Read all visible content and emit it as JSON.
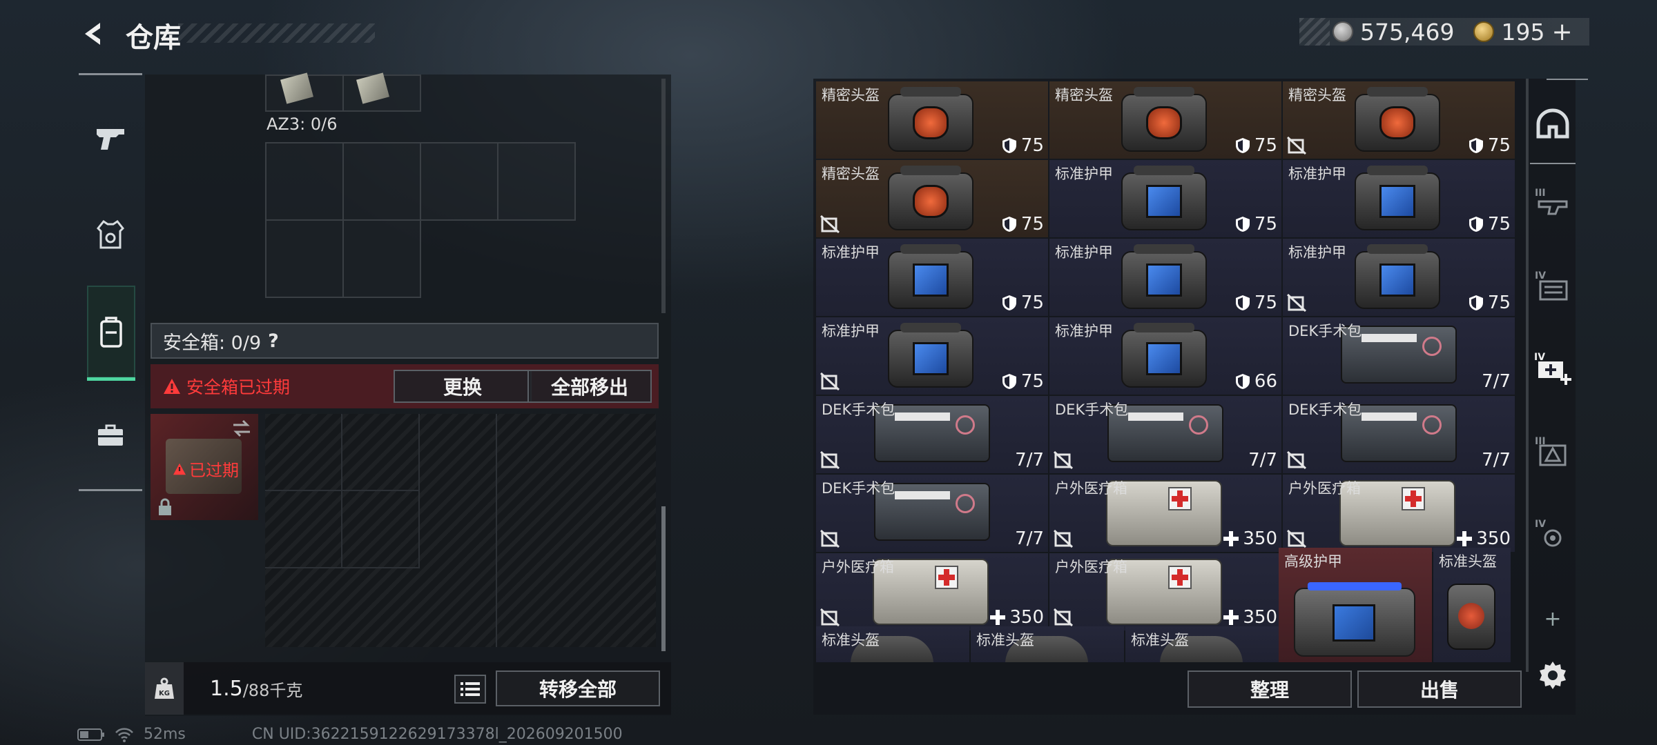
{
  "header": {
    "title": "仓库",
    "back_icon": "back-arrow-icon"
  },
  "currency": {
    "silver": "575,469",
    "gold": "195",
    "gold_plus": "+"
  },
  "left_nav": {
    "items": [
      {
        "name": "weapons",
        "icon": "pistol-icon"
      },
      {
        "name": "gear",
        "icon": "armor-vest-icon"
      },
      {
        "name": "backpack",
        "icon": "backpack-icon",
        "active": true
      },
      {
        "name": "toolbox",
        "icon": "briefcase-icon"
      }
    ]
  },
  "storage": {
    "az3_label": "AZ3: 0/6"
  },
  "safebox": {
    "label": "安全箱: 0/9",
    "help": "?",
    "expired_msg": "安全箱已过期",
    "replace_btn": "更换",
    "remove_all_btn": "全部移出",
    "thumb_tag": "已过期"
  },
  "footer": {
    "weight": "1.5",
    "weight_max": "/88千克",
    "kg_icon": "KG",
    "transfer_all_btn": "转移全部",
    "sort_btn": "整理",
    "sell_btn": "出售"
  },
  "inventory": {
    "items": [
      {
        "name": "精密头盔",
        "value": "75",
        "kind": "helmet",
        "tone": "brown",
        "value_icon": "shield",
        "nosell": false
      },
      {
        "name": "精密头盔",
        "value": "75",
        "kind": "helmet",
        "tone": "brown",
        "value_icon": "shield",
        "nosell": false
      },
      {
        "name": "精密头盔",
        "value": "75",
        "kind": "helmet",
        "tone": "brown",
        "value_icon": "shield",
        "nosell": true
      },
      {
        "name": "精密头盔",
        "value": "75",
        "kind": "helmet",
        "tone": "brown",
        "value_icon": "shield",
        "nosell": true
      },
      {
        "name": "标准护甲",
        "value": "75",
        "kind": "armor",
        "tone": "navy",
        "value_icon": "shield",
        "nosell": false
      },
      {
        "name": "标准护甲",
        "value": "75",
        "kind": "armor",
        "tone": "navy",
        "value_icon": "shield",
        "nosell": false
      },
      {
        "name": "标准护甲",
        "value": "75",
        "kind": "armor",
        "tone": "navy",
        "value_icon": "shield",
        "nosell": false
      },
      {
        "name": "标准护甲",
        "value": "75",
        "kind": "armor",
        "tone": "navy",
        "value_icon": "shield",
        "nosell": false
      },
      {
        "name": "标准护甲",
        "value": "75",
        "kind": "armor",
        "tone": "navy",
        "value_icon": "shield",
        "nosell": true
      },
      {
        "name": "标准护甲",
        "value": "75",
        "kind": "armor",
        "tone": "navy",
        "value_icon": "shield",
        "nosell": true
      },
      {
        "name": "标准护甲",
        "value": "66",
        "kind": "armor",
        "tone": "navy",
        "value_icon": "shield",
        "nosell": false
      },
      {
        "name": "DEK手术包",
        "value": "7/7",
        "kind": "kit",
        "tone": "navy",
        "value_icon": "",
        "nosell": false
      },
      {
        "name": "DEK手术包",
        "value": "7/7",
        "kind": "kit",
        "tone": "navy",
        "value_icon": "",
        "nosell": true
      },
      {
        "name": "DEK手术包",
        "value": "7/7",
        "kind": "kit",
        "tone": "navy",
        "value_icon": "",
        "nosell": true
      },
      {
        "name": "DEK手术包",
        "value": "7/7",
        "kind": "kit",
        "tone": "navy",
        "value_icon": "",
        "nosell": true
      },
      {
        "name": "DEK手术包",
        "value": "7/7",
        "kind": "kit",
        "tone": "navy",
        "value_icon": "",
        "nosell": true
      },
      {
        "name": "户外医疗箱",
        "value": "350",
        "kind": "medbox",
        "tone": "navy",
        "value_icon": "plus",
        "nosell": true
      },
      {
        "name": "户外医疗箱",
        "value": "350",
        "kind": "medbox",
        "tone": "navy",
        "value_icon": "plus",
        "nosell": true
      },
      {
        "name": "户外医疗箱",
        "value": "350",
        "kind": "medbox",
        "tone": "navy",
        "value_icon": "plus",
        "nosell": true
      },
      {
        "name": "户外医疗箱",
        "value": "350",
        "kind": "medbox",
        "tone": "navy",
        "value_icon": "plus",
        "nosell": true
      }
    ],
    "special": [
      {
        "name": "高级护甲"
      },
      {
        "name": "标准头盔"
      }
    ],
    "bottom_row": [
      {
        "name": "标准头盔"
      },
      {
        "name": "标准头盔"
      },
      {
        "name": "标准头盔"
      }
    ]
  },
  "right_nav": {
    "items": [
      {
        "icon": "helmet-outline-icon"
      },
      {
        "icon": "tier3-gun-icon",
        "tier": "III"
      },
      {
        "icon": "tier4-armor-icon",
        "tier": "IV"
      },
      {
        "icon": "tier4-medkit-add-icon",
        "tier": "IV"
      },
      {
        "icon": "tier3-item-icon",
        "tier": "III"
      },
      {
        "icon": "tier4-parts-icon",
        "tier": "IV"
      },
      {
        "icon": "add-icon",
        "label": "+"
      },
      {
        "icon": "settings-gear-icon"
      }
    ]
  },
  "status": {
    "ping": "52ms",
    "uid": "CN UID:3622159122629173378l_202609201500"
  },
  "colors": {
    "accent_green": "#4ed6a0",
    "expired_red": "#ff3b3b",
    "cell_brown": "#3b2e24",
    "cell_navy": "#25273a",
    "cell_red": "#5a2a2e"
  }
}
